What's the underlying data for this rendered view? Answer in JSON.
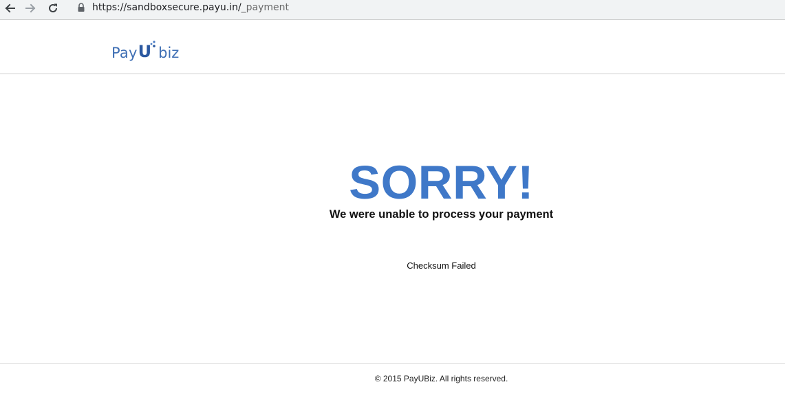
{
  "browser": {
    "url_host": "https://sandboxsecure.payu.in/",
    "url_path": "_payment",
    "icons": [
      "back-arrow-icon",
      "forward-arrow-icon",
      "reload-icon",
      "lock-icon"
    ]
  },
  "header": {
    "logo_pay": "Pay",
    "logo_u": "U",
    "logo_biz": "biz",
    "logo_color": "#3f6fb4"
  },
  "main": {
    "heading": "SORRY!",
    "heading_color": "#3f78c8",
    "subtitle": "We were unable to process your payment",
    "error": "Checksum Failed"
  },
  "footer": {
    "copyright": "© 2015 PayUBiz. All rights reserved."
  }
}
